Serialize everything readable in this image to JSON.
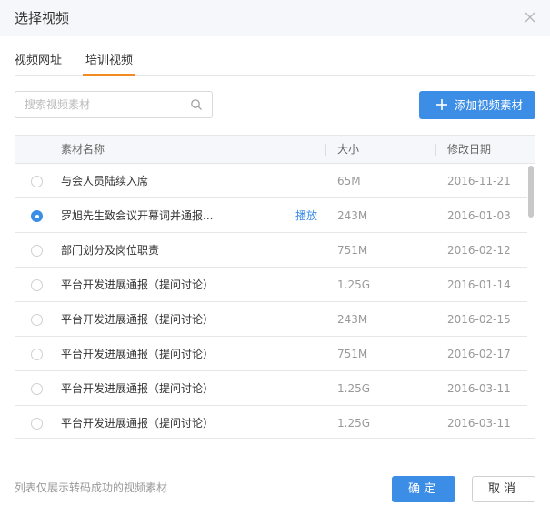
{
  "dialog": {
    "title": "选择视频"
  },
  "tabs": [
    {
      "label": "视频网址",
      "active": false
    },
    {
      "label": "培训视频",
      "active": true
    }
  ],
  "search": {
    "placeholder": "搜索视频素材",
    "value": ""
  },
  "toolbar": {
    "add_label": "添加视频素材"
  },
  "table": {
    "columns": {
      "name": "素材名称",
      "size": "大小",
      "date": "修改日期"
    },
    "play_label": "播放",
    "rows": [
      {
        "name": "与会人员陆续入席",
        "size": "65M",
        "date": "2016-11-21",
        "selected": false
      },
      {
        "name": "罗旭先生致会议开幕词并通报...",
        "size": "243M",
        "date": "2016-01-03",
        "selected": true
      },
      {
        "name": "部门划分及岗位职责",
        "size": "751M",
        "date": "2016-02-12",
        "selected": false
      },
      {
        "name": "平台开发进展通报（提问讨论）",
        "size": "1.25G",
        "date": "2016-01-14",
        "selected": false
      },
      {
        "name": "平台开发进展通报（提问讨论）",
        "size": "243M",
        "date": "2016-02-15",
        "selected": false
      },
      {
        "name": "平台开发进展通报（提问讨论）",
        "size": "751M",
        "date": "2016-02-17",
        "selected": false
      },
      {
        "name": "平台开发进展通报（提问讨论）",
        "size": "1.25G",
        "date": "2016-03-11",
        "selected": false
      },
      {
        "name": "平台开发进展通报（提问讨论）",
        "size": "1.25G",
        "date": "2016-03-11",
        "selected": false
      }
    ]
  },
  "footer": {
    "note": "列表仅展示转码成功的视频素材",
    "ok_label": "确定",
    "cancel_label": "取消"
  },
  "colors": {
    "accent": "#3c8de6",
    "tab_active": "#f08c20",
    "header_bg": "#f5f7fa"
  },
  "icons": {
    "close": "close-icon",
    "search": "search-icon",
    "add": "plus-icon"
  }
}
